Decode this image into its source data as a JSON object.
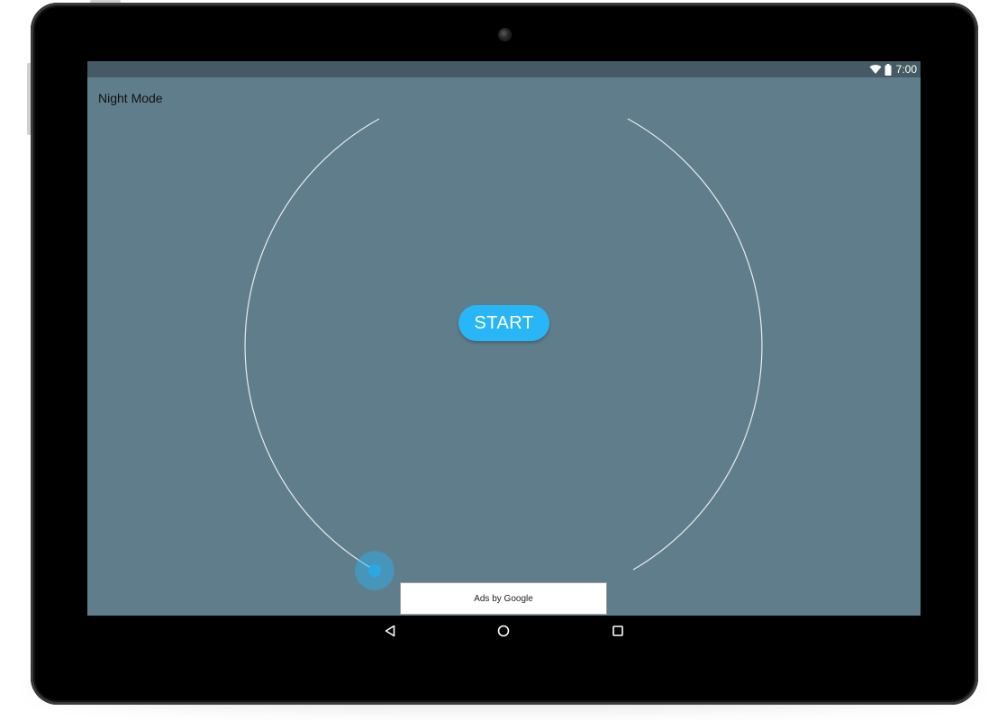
{
  "status_bar": {
    "time": "7:00",
    "icons": [
      "wifi-icon",
      "battery-icon"
    ],
    "background": "#455a64"
  },
  "app": {
    "title": "Night Mode",
    "background": "#607d8b"
  },
  "timer": {
    "start_label": "START",
    "accent_color": "#29b6f6"
  },
  "ad": {
    "label": "Ads by Google"
  },
  "nav_bar": {
    "icons": [
      "back-icon",
      "home-icon",
      "recents-icon"
    ]
  }
}
